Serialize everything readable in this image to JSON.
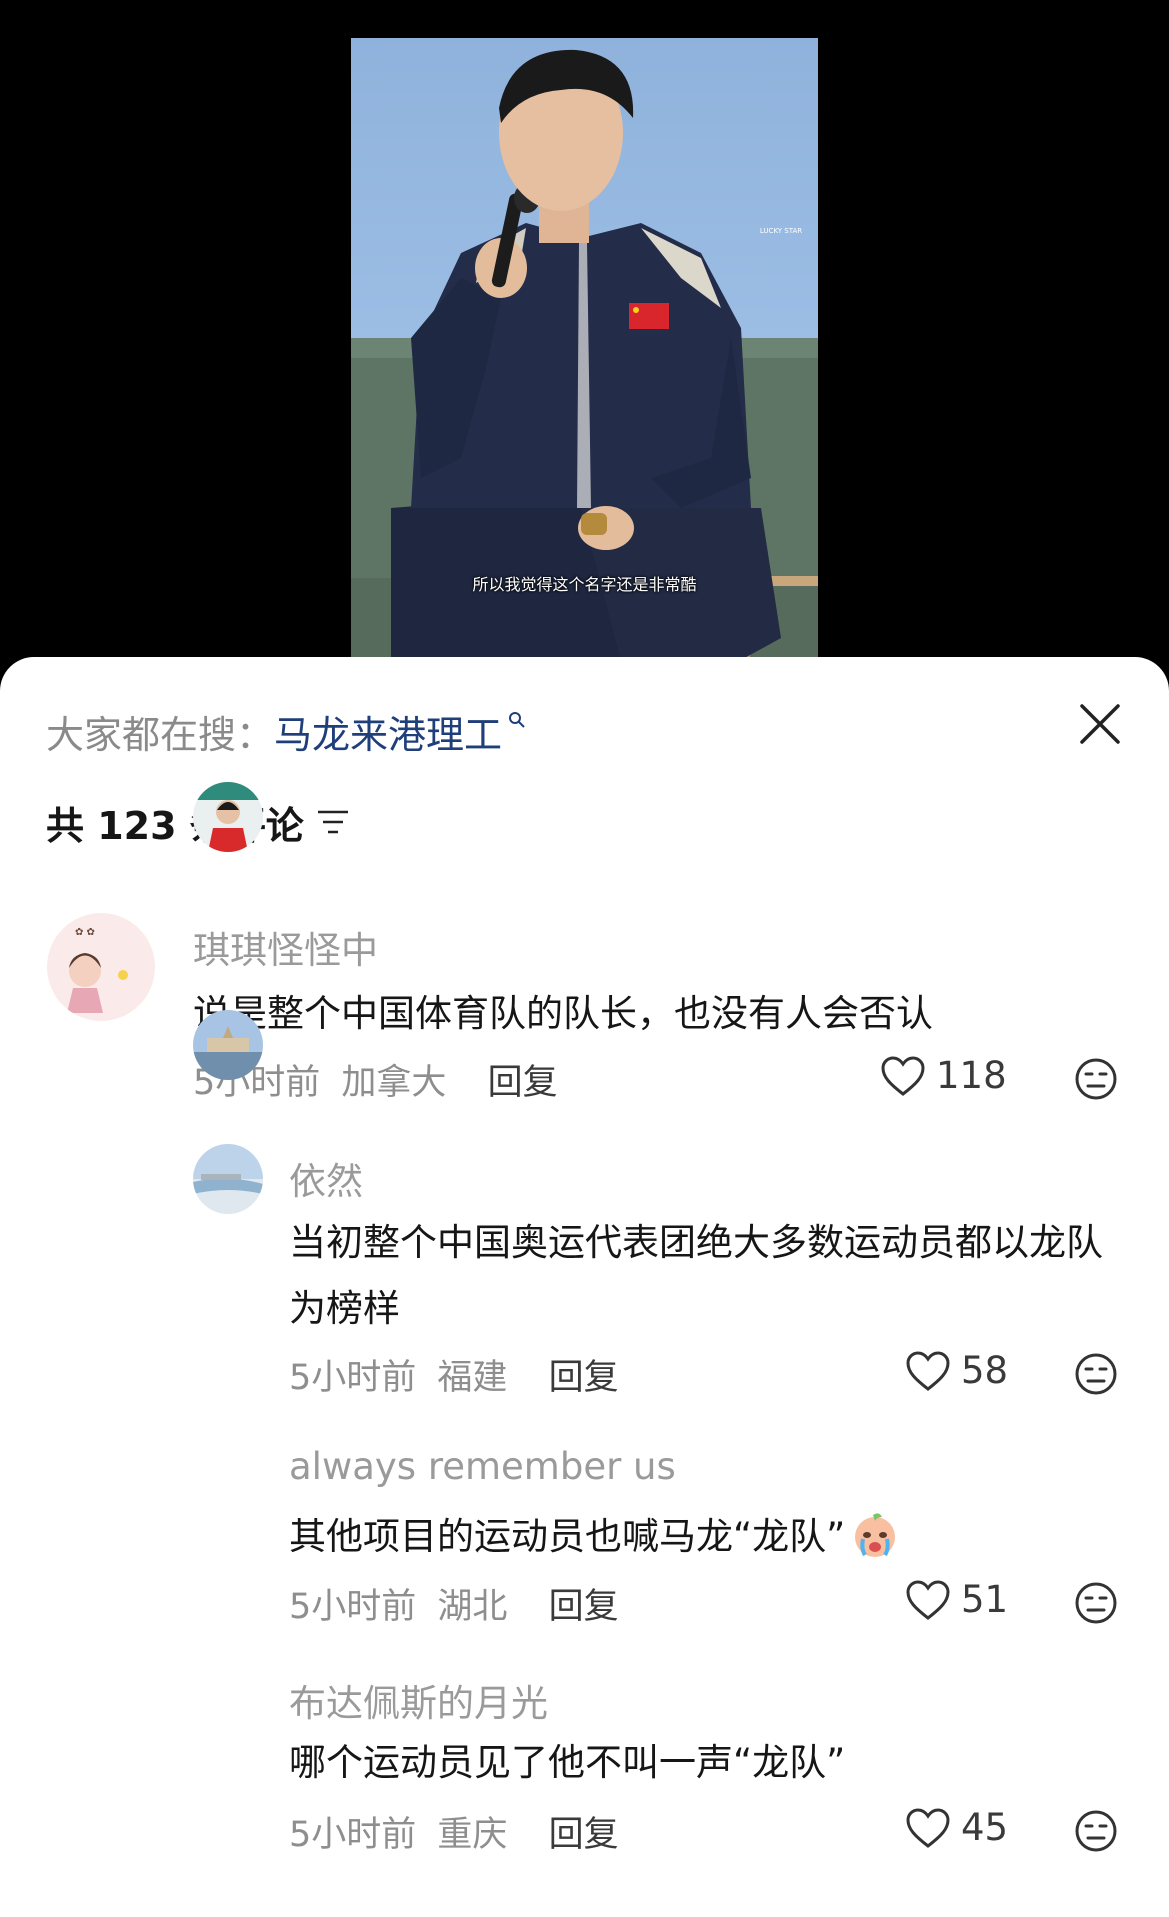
{
  "video": {
    "subtitle": "所以我觉得这个名字还是非常酷",
    "backdrop_logo": "LUCKY STAR"
  },
  "sheet": {
    "search_prefix": "大家都在搜：",
    "search_term": "马龙来港理工",
    "comment_count": "共 123 条评论",
    "colors": {
      "search_term": "#1f3f7a",
      "text": "#161616",
      "muted": "#9a9a9a"
    }
  },
  "comments": [
    {
      "name": "琪琪怪怪中",
      "text": "说是整个中国体育队的队长，也没有人会否认",
      "time": "5小时前",
      "location": "加拿大",
      "reply": "回复",
      "likes": "118"
    },
    {
      "name": "依然",
      "text": "当初整个中国奥运代表团绝大多数运动员都以龙队为榜样",
      "time": "5小时前",
      "location": "福建",
      "reply": "回复",
      "likes": "58"
    },
    {
      "name": "always remember us",
      "text": "其他项目的运动员也喊马龙“龙队”",
      "time": "5小时前",
      "location": "湖北",
      "reply": "回复",
      "likes": "51"
    },
    {
      "name": "布达佩斯的月光",
      "text": "哪个运动员见了他不叫一声“龙队”",
      "time": "5小时前",
      "location": "重庆",
      "reply": "回复",
      "likes": "45"
    }
  ]
}
